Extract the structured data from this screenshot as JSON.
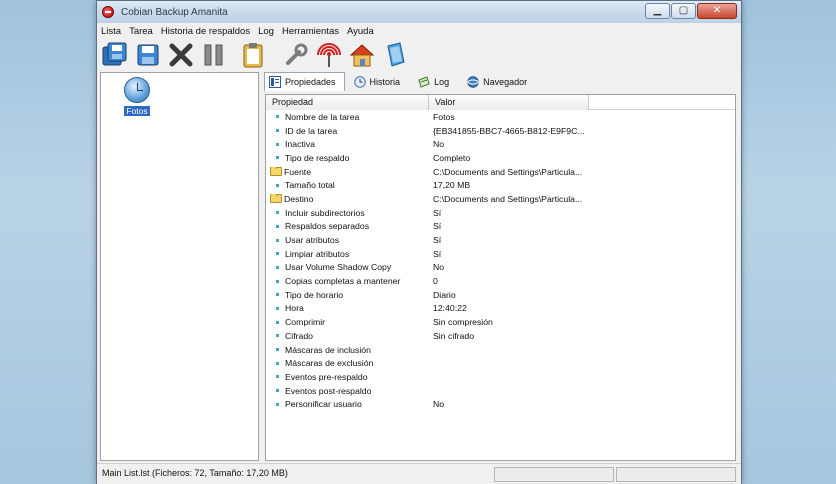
{
  "window": {
    "title": "Cobian Backup Amanita"
  },
  "menu": [
    "Lista",
    "Tarea",
    "Historia de respaldos",
    "Log",
    "Herramientas",
    "Ayuda"
  ],
  "toolbar": {
    "icons": [
      "save-all-icon",
      "save-icon",
      "delete-icon",
      "pause-icon",
      "clipboard-icon",
      "tools-icon",
      "antenna-icon",
      "home-icon",
      "help-book-icon"
    ]
  },
  "task_list": {
    "items": [
      {
        "label": "Fotos",
        "icon": "clock-icon"
      }
    ]
  },
  "tabs": [
    {
      "label": "Propiedades",
      "icon": "properties-icon",
      "active": true
    },
    {
      "label": "Historia",
      "icon": "history-clock-icon",
      "active": false
    },
    {
      "label": "Log",
      "icon": "log-icon",
      "active": false
    },
    {
      "label": "Navegador",
      "icon": "browser-icon",
      "active": false
    }
  ],
  "properties": {
    "columns": [
      "Propiedad",
      "Valor"
    ],
    "rows": [
      {
        "prop": "Nombre de la tarea",
        "value": "Fotos",
        "kind": "bullet"
      },
      {
        "prop": "ID de la tarea",
        "value": "{EB341855-BBC7-4665-B812-E9F9C...",
        "kind": "bullet"
      },
      {
        "prop": "Inactiva",
        "value": "No",
        "kind": "bullet"
      },
      {
        "prop": "Tipo de respaldo",
        "value": "Completo",
        "kind": "bullet"
      },
      {
        "prop": "Fuente",
        "value": "C:\\Documents and Settings\\Particula...",
        "kind": "folder"
      },
      {
        "prop": "Tamaño total",
        "value": "17,20 MB",
        "kind": "bullet"
      },
      {
        "prop": "Destino",
        "value": "C:\\Documents and Settings\\Particula...",
        "kind": "folder"
      },
      {
        "prop": "Incluir subdirectorios",
        "value": "Sí",
        "kind": "bullet"
      },
      {
        "prop": "Respaldos separados",
        "value": "Sí",
        "kind": "bullet"
      },
      {
        "prop": "Usar atributos",
        "value": "Sí",
        "kind": "bullet"
      },
      {
        "prop": "Limpiar atributos",
        "value": "Sí",
        "kind": "bullet"
      },
      {
        "prop": "Usar Volume Shadow Copy",
        "value": "No",
        "kind": "bullet"
      },
      {
        "prop": "Copias completas a mantener",
        "value": "0",
        "kind": "bullet"
      },
      {
        "prop": "Tipo de horario",
        "value": "Diario",
        "kind": "bullet"
      },
      {
        "prop": "Hora",
        "value": "12:40:22",
        "kind": "bullet"
      },
      {
        "prop": "Comprimir",
        "value": "Sin compresión",
        "kind": "bullet"
      },
      {
        "prop": "Cifrado",
        "value": "Sin cifrado",
        "kind": "bullet"
      },
      {
        "prop": "Máscaras de inclusión",
        "value": "",
        "kind": "bullet"
      },
      {
        "prop": "Máscaras de exclusión",
        "value": "",
        "kind": "bullet"
      },
      {
        "prop": "Eventos pre-respaldo",
        "value": "",
        "kind": "bullet"
      },
      {
        "prop": "Eventos post-respaldo",
        "value": "",
        "kind": "bullet"
      },
      {
        "prop": "Personificar usuario",
        "value": "No",
        "kind": "bullet"
      }
    ]
  },
  "status": {
    "text": "Main List.lst (Ficheros: 72, Tamaño: 17,20 MB)"
  },
  "colors": {
    "selection": "#3168c6",
    "bullet": "#4aa0c9",
    "folder": "#f6d56b"
  }
}
